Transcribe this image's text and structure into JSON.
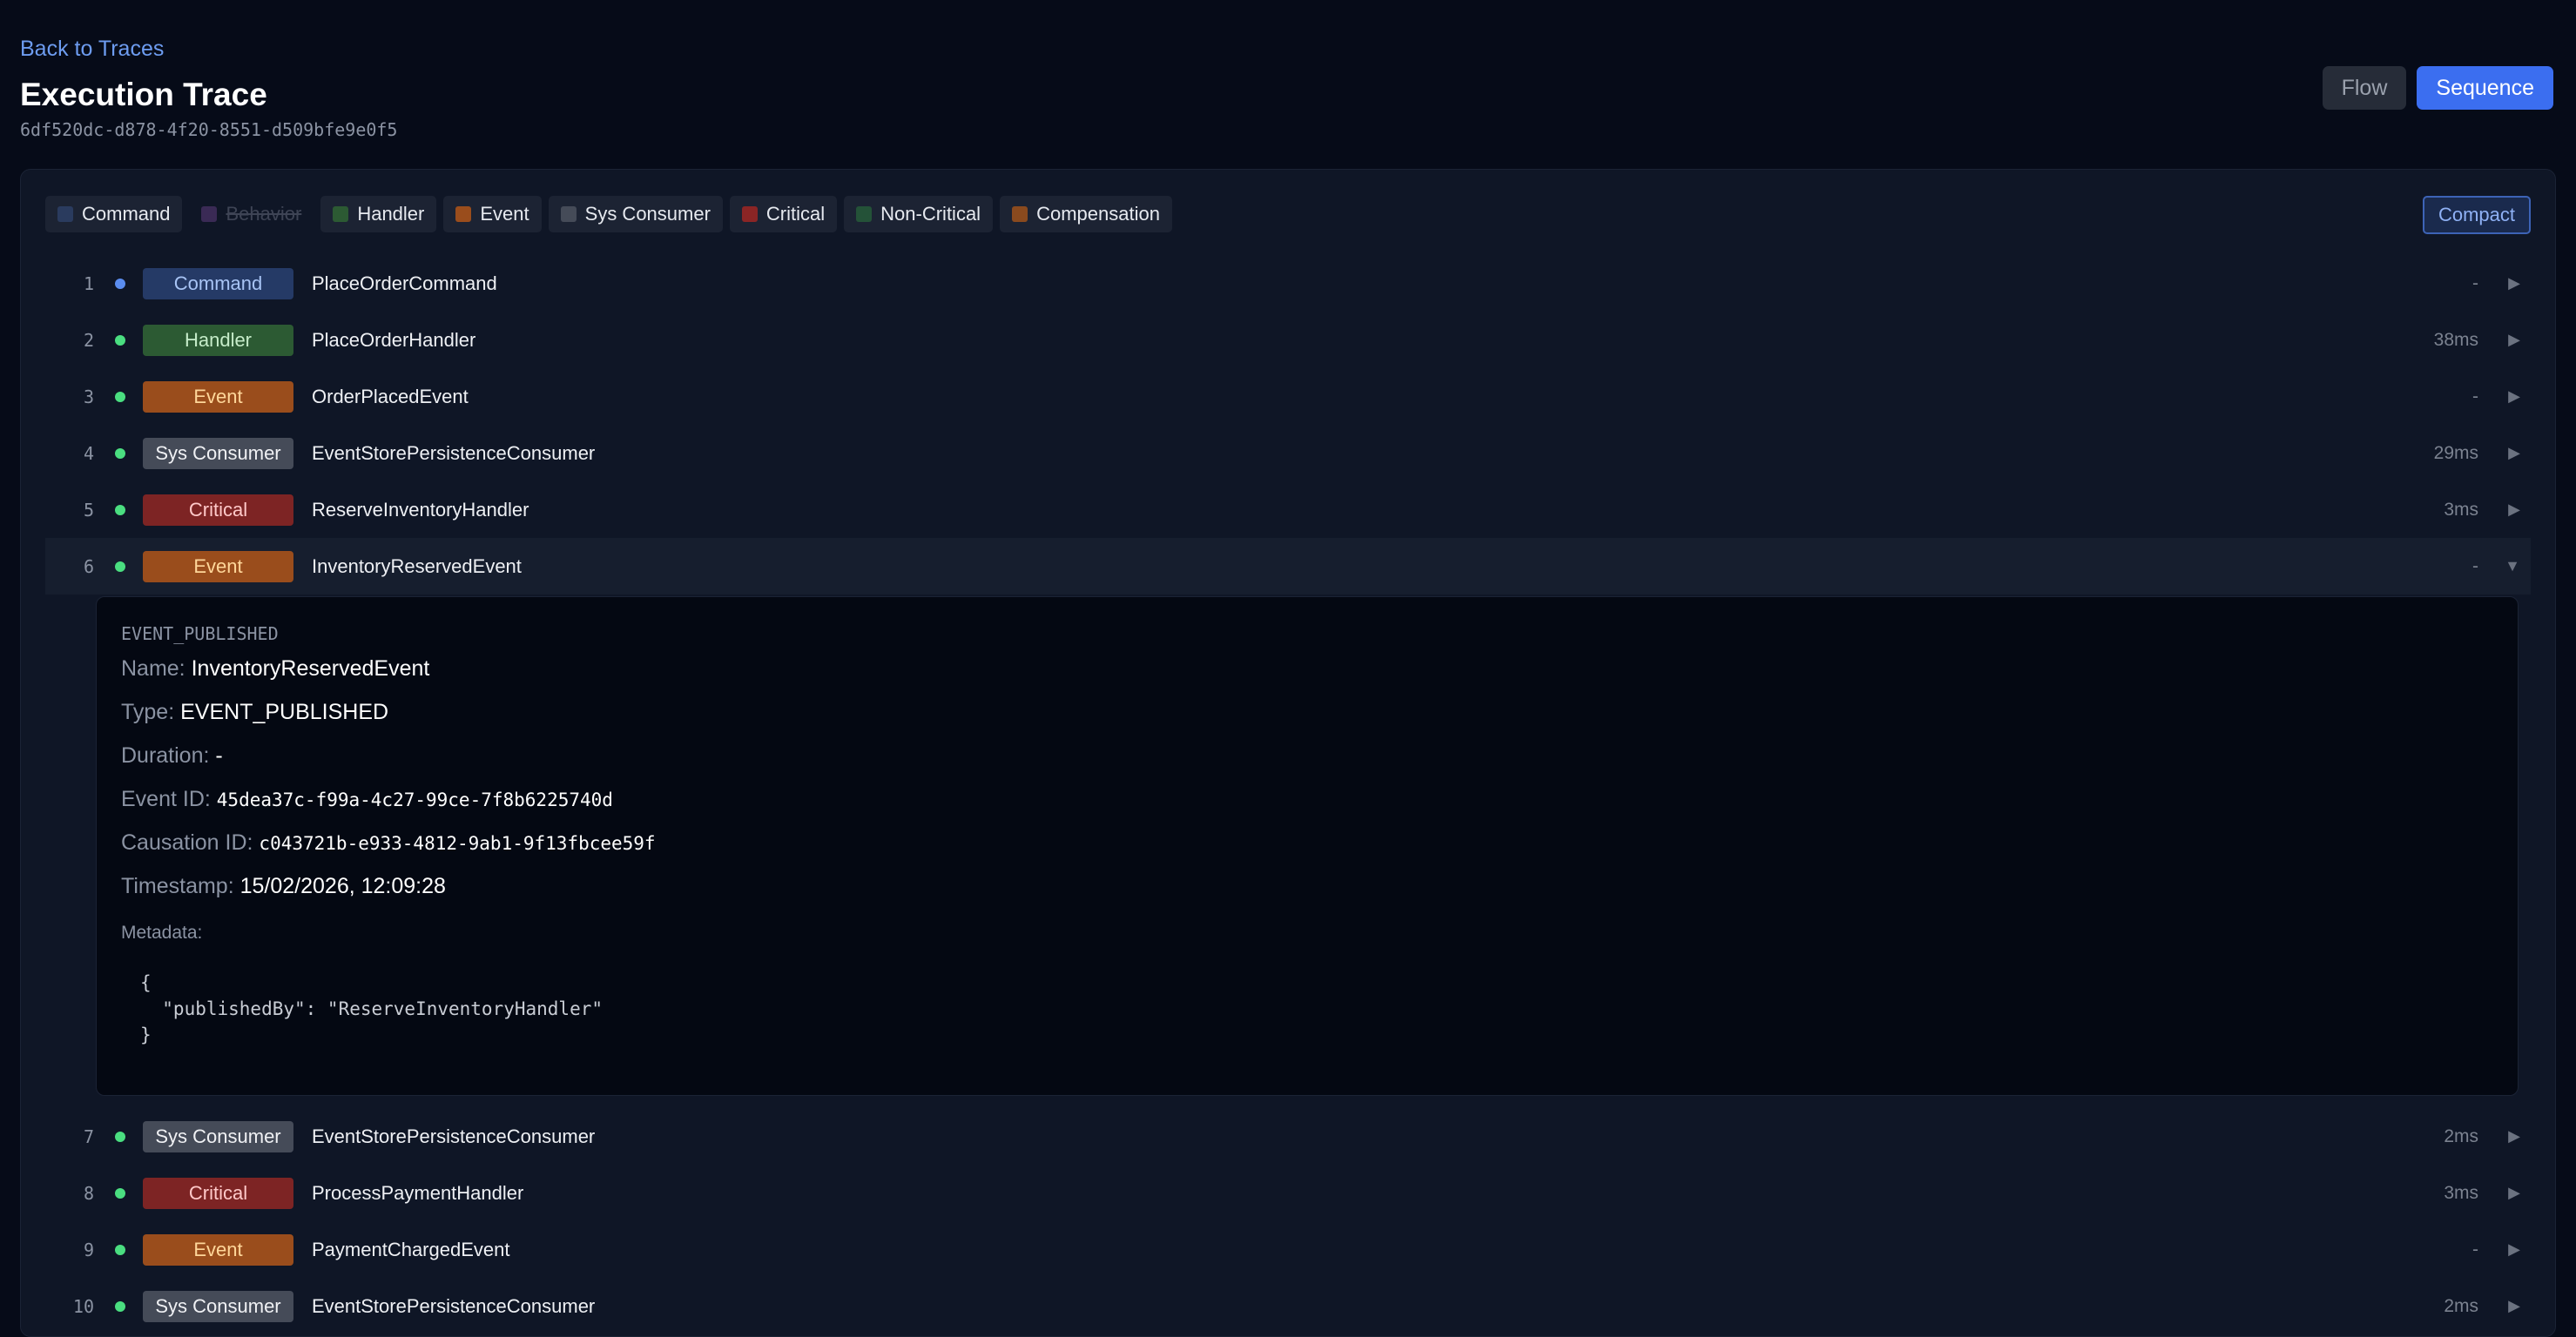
{
  "nav": {
    "back_label": "Back to Traces"
  },
  "header": {
    "title": "Execution Trace",
    "trace_id": "6df520dc-d878-4f20-8551-d509bfe9e0f5"
  },
  "view_modes": {
    "flow": "Flow",
    "sequence": "Sequence",
    "active": "Sequence"
  },
  "legend": [
    {
      "label": "Command",
      "color": "#2a3b5e",
      "enabled": true
    },
    {
      "label": "Behavior",
      "color": "#3a2a55",
      "enabled": false
    },
    {
      "label": "Handler",
      "color": "#2c5a33",
      "enabled": true
    },
    {
      "label": "Event",
      "color": "#9a4d1c",
      "enabled": true
    },
    {
      "label": "Sys Consumer",
      "color": "#454b58",
      "enabled": true
    },
    {
      "label": "Critical",
      "color": "#8b2525",
      "enabled": true
    },
    {
      "label": "Non-Critical",
      "color": "#245238",
      "enabled": true
    },
    {
      "label": "Compensation",
      "color": "#8a4a1e",
      "enabled": true
    }
  ],
  "compact_label": "Compact",
  "badge_styles": {
    "Command": {
      "bg": "#253a66",
      "fg": "#a8c4f5"
    },
    "Handler": {
      "bg": "#2c5a33",
      "fg": "#c6ecc9"
    },
    "Event": {
      "bg": "#9a4d1c",
      "fg": "#ffd79a"
    },
    "Sys Consumer": {
      "bg": "#454b58",
      "fg": "#f0f1f4"
    },
    "Critical": {
      "bg": "#7d2424",
      "fg": "#ffc9c9"
    }
  },
  "status_colors": {
    "pending": "#5b8def",
    "success": "#4ade80"
  },
  "steps": [
    {
      "num": "1",
      "type": "Command",
      "name": "PlaceOrderCommand",
      "duration": "-",
      "status": "pending",
      "expanded": false
    },
    {
      "num": "2",
      "type": "Handler",
      "name": "PlaceOrderHandler",
      "duration": "38ms",
      "status": "success",
      "expanded": false
    },
    {
      "num": "3",
      "type": "Event",
      "name": "OrderPlacedEvent",
      "duration": "-",
      "status": "success",
      "expanded": false
    },
    {
      "num": "4",
      "type": "Sys Consumer",
      "name": "EventStorePersistenceConsumer",
      "duration": "29ms",
      "status": "success",
      "expanded": false
    },
    {
      "num": "5",
      "type": "Critical",
      "name": "ReserveInventoryHandler",
      "duration": "3ms",
      "status": "success",
      "expanded": false
    },
    {
      "num": "6",
      "type": "Event",
      "name": "InventoryReservedEvent",
      "duration": "-",
      "status": "success",
      "expanded": true
    },
    {
      "num": "7",
      "type": "Sys Consumer",
      "name": "EventStorePersistenceConsumer",
      "duration": "2ms",
      "status": "success",
      "expanded": false
    },
    {
      "num": "8",
      "type": "Critical",
      "name": "ProcessPaymentHandler",
      "duration": "3ms",
      "status": "success",
      "expanded": false
    },
    {
      "num": "9",
      "type": "Event",
      "name": "PaymentChargedEvent",
      "duration": "-",
      "status": "success",
      "expanded": false
    },
    {
      "num": "10",
      "type": "Sys Consumer",
      "name": "EventStorePersistenceConsumer",
      "duration": "2ms",
      "status": "success",
      "expanded": false
    }
  ],
  "icons": {
    "collapsed": "▶",
    "expanded": "▼"
  },
  "detail": {
    "kind": "EVENT_PUBLISHED",
    "name_label": "Name:",
    "name_value": "InventoryReservedEvent",
    "type_label": "Type:",
    "type_value": "EVENT_PUBLISHED",
    "duration_label": "Duration:",
    "duration_value": "-",
    "event_id_label": "Event ID:",
    "event_id_value": "45dea37c-f99a-4c27-99ce-7f8b6225740d",
    "causation_id_label": "Causation ID:",
    "causation_id_value": "c043721b-e933-4812-9ab1-9f13fbcee59f",
    "timestamp_label": "Timestamp:",
    "timestamp_value": "15/02/2026, 12:09:28",
    "metadata_label": "Metadata:",
    "metadata_json": "{\n  \"publishedBy\": \"ReserveInventoryHandler\"\n}"
  }
}
